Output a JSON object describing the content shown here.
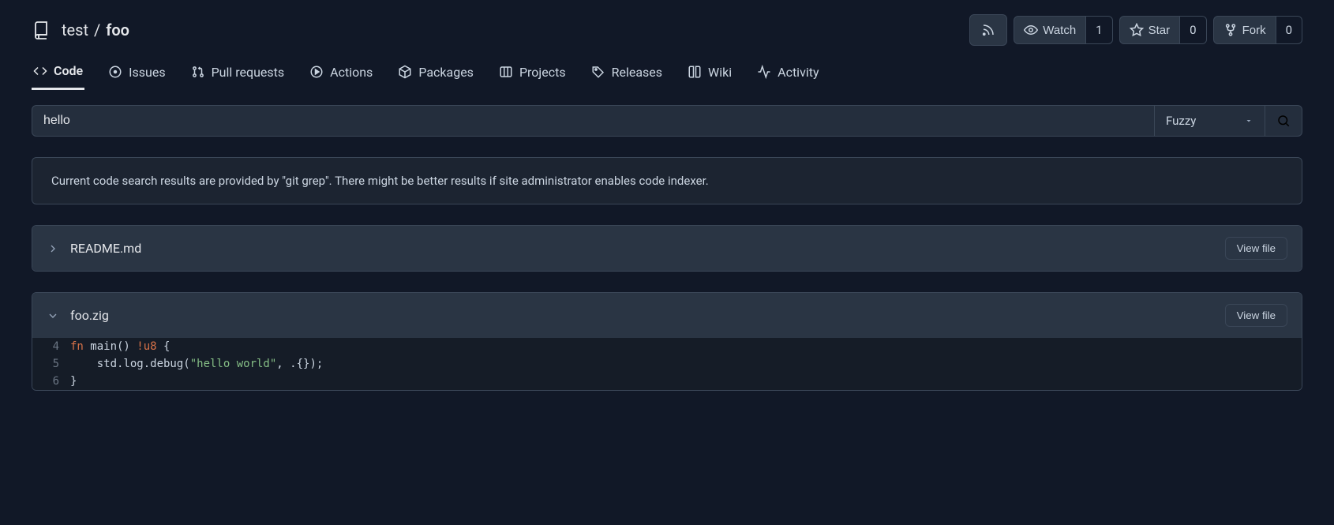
{
  "repo": {
    "owner": "test",
    "name": "foo"
  },
  "header_actions": {
    "rss": "RSS",
    "watch": {
      "label": "Watch",
      "count": "1"
    },
    "star": {
      "label": "Star",
      "count": "0"
    },
    "fork": {
      "label": "Fork",
      "count": "0"
    }
  },
  "tabs": {
    "code": "Code",
    "issues": "Issues",
    "pulls": "Pull requests",
    "actions": "Actions",
    "packages": "Packages",
    "projects": "Projects",
    "releases": "Releases",
    "wiki": "Wiki",
    "activity": "Activity"
  },
  "search": {
    "value": "hello",
    "mode": "Fuzzy"
  },
  "notice": "Current code search results are provided by \"git grep\". There might be better results if site administrator enables code indexer.",
  "results": [
    {
      "filename": "README.md",
      "expanded": false,
      "view_label": "View file"
    },
    {
      "filename": "foo.zig",
      "expanded": true,
      "view_label": "View file",
      "lines": [
        {
          "n": "4",
          "segments": [
            {
              "t": "fn",
              "c": "kw"
            },
            {
              "t": " main() "
            },
            {
              "t": "!u8",
              "c": "ty"
            },
            {
              "t": " {"
            }
          ]
        },
        {
          "n": "5",
          "segments": [
            {
              "t": "    std.log.debug("
            },
            {
              "t": "\"hello world\"",
              "c": "str"
            },
            {
              "t": ", .{});"
            }
          ]
        },
        {
          "n": "6",
          "segments": [
            {
              "t": "}"
            }
          ]
        }
      ]
    }
  ]
}
